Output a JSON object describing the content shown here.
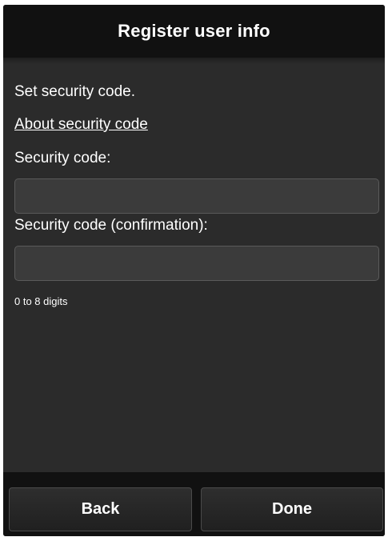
{
  "header": {
    "title": "Register user info"
  },
  "main": {
    "instruction": "Set security code.",
    "about_link": "About security code",
    "security_code_label": "Security code:",
    "security_code_value": "",
    "confirmation_label": "Security code (confirmation):",
    "confirmation_value": "",
    "hint": "0 to 8 digits"
  },
  "footer": {
    "back_label": "Back",
    "done_label": "Done"
  },
  "colors": {
    "panel_background": "#2b2b2b",
    "bar_background": "#111111",
    "text": "#ffffff",
    "input_background": "#3b3b3b"
  }
}
